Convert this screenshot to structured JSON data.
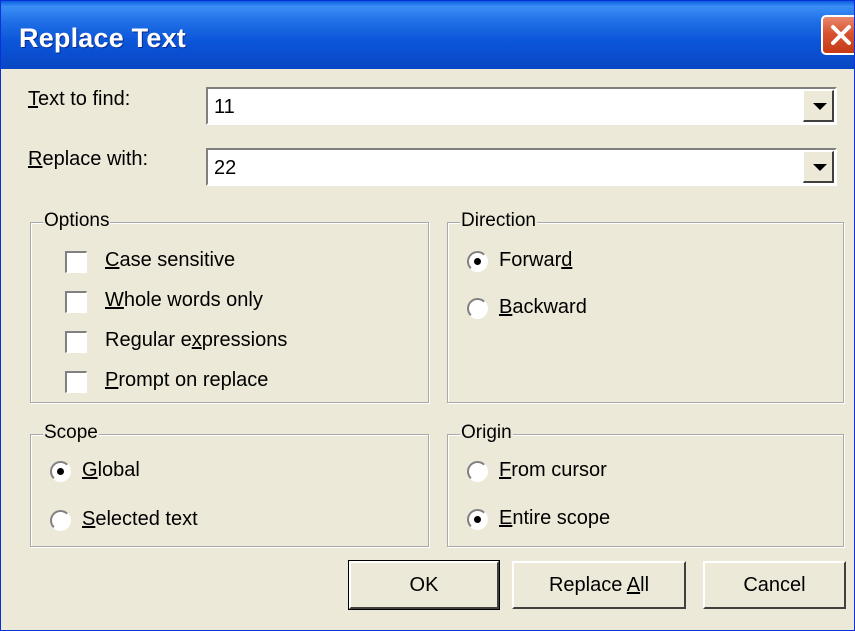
{
  "window": {
    "title": "Replace Text"
  },
  "fields": {
    "find": {
      "label_key": "T",
      "label_rest": "ext to find:",
      "value": "11"
    },
    "replace": {
      "label_key": "R",
      "label_rest": "eplace with:",
      "value": "22"
    }
  },
  "options": {
    "title": "Options",
    "items": [
      {
        "pre": "",
        "key": "C",
        "post": "ase sensitive",
        "checked": false
      },
      {
        "pre": "",
        "key": "W",
        "post": "hole words only",
        "checked": false
      },
      {
        "pre": "Regular e",
        "key": "x",
        "post": "pressions",
        "checked": false
      },
      {
        "pre": "",
        "key": "P",
        "post": "rompt on replace",
        "checked": false
      }
    ]
  },
  "direction": {
    "title": "Direction",
    "items": [
      {
        "pre": "Forwar",
        "key": "d",
        "post": "",
        "selected": true
      },
      {
        "pre": "",
        "key": "B",
        "post": "ackward",
        "selected": false
      }
    ]
  },
  "scope": {
    "title": "Scope",
    "items": [
      {
        "pre": "",
        "key": "G",
        "post": "lobal",
        "selected": true
      },
      {
        "pre": "",
        "key": "S",
        "post": "elected text",
        "selected": false
      }
    ]
  },
  "origin": {
    "title": "Origin",
    "items": [
      {
        "pre": "",
        "key": "F",
        "post": "rom cursor",
        "selected": false
      },
      {
        "pre": "",
        "key": "E",
        "post": "ntire scope",
        "selected": true
      }
    ]
  },
  "buttons": {
    "ok": "OK",
    "replace_all_pre": "Replace ",
    "replace_all_key": "A",
    "replace_all_post": "ll",
    "cancel": "Cancel"
  },
  "icons": {
    "close": "close-icon",
    "dropdown": "chevron-down-icon"
  },
  "colors": {
    "title_bar": "#0a4ccc",
    "close_button": "#d8522f",
    "dialog_bg": "#ece9d8"
  }
}
